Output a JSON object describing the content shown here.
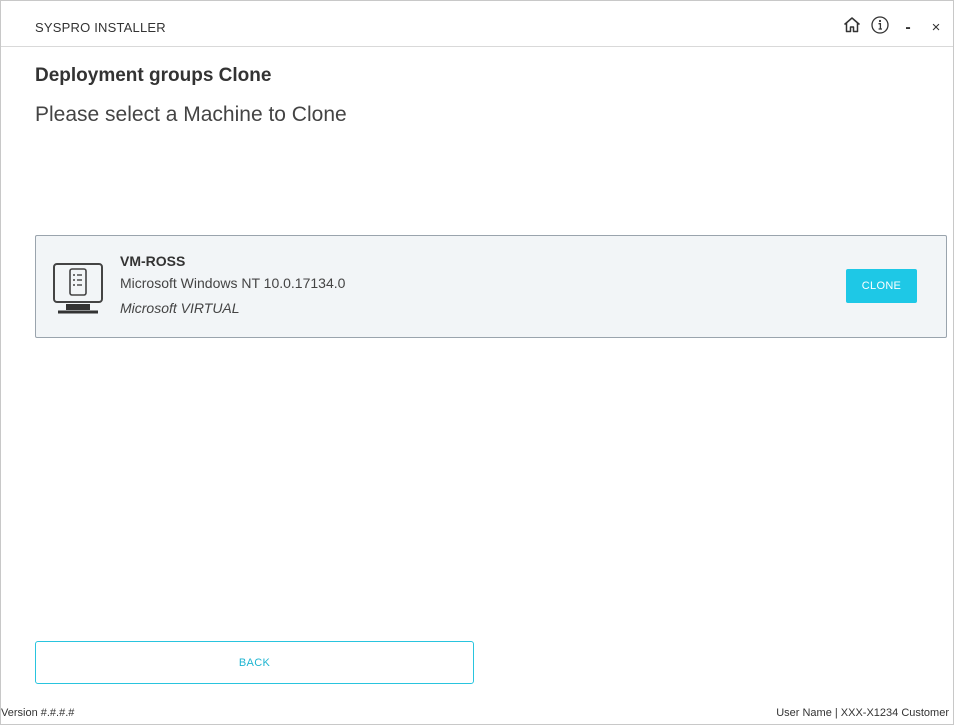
{
  "window": {
    "title": "SYSPRO INSTALLER",
    "controls": {
      "home_icon": "home-icon",
      "info_icon": "info-icon",
      "minimize": "-",
      "close": "×"
    }
  },
  "page": {
    "heading": "Deployment groups Clone",
    "subheading": "Please select a Machine to Clone"
  },
  "machines": [
    {
      "icon": "computer-icon",
      "name": "VM-ROSS",
      "os": "Microsoft Windows NT 10.0.17134.0",
      "type": "Microsoft VIRTUAL",
      "action_label": "CLONE"
    }
  ],
  "actions": {
    "back_label": "BACK"
  },
  "footer": {
    "version": "Version #.#.#.#",
    "user_info": "User Name | XXX-X1234 Customer"
  },
  "colors": {
    "accent": "#1ec8e6",
    "card_background": "#f2f5f7",
    "card_border": "#9aa4ad"
  }
}
